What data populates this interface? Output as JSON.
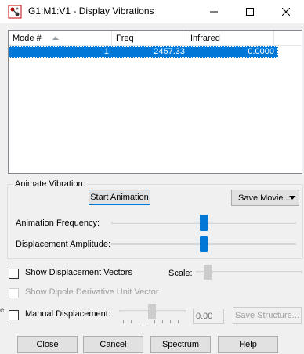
{
  "window": {
    "title": "G1:M1:V1 - Display Vibrations",
    "icons": {
      "app": "molecule-app-icon",
      "minimize": "minimize-icon",
      "maximize": "maximize-icon",
      "close": "close-icon"
    }
  },
  "list": {
    "columns": [
      "Mode #",
      "Freq",
      "Infrared"
    ],
    "sorted_column": "Mode #",
    "rows": [
      {
        "mode": "1",
        "freq": "2457.33",
        "infrared": "0.0000",
        "selected": true
      }
    ]
  },
  "animate": {
    "group_label": "Animate Vibration:",
    "start_button": "Start Animation",
    "save_movie_button": "Save Movie...",
    "frequency_label": "Animation Frequency:",
    "frequency_level": 0.5,
    "amplitude_label": "Displacement Amplitude:",
    "amplitude_level": 0.5
  },
  "options": {
    "show_displacement_vectors": {
      "label": "Show Displacement Vectors",
      "checked": false
    },
    "scale_label": "Scale:",
    "show_dipole": {
      "label": "Show Dipole Derivative Unit Vector",
      "checked": false,
      "enabled": false
    },
    "manual_displacement": {
      "label": "Manual Displacement:",
      "checked": false
    },
    "manual_value": "0.00",
    "save_structure_button": "Save Structure..."
  },
  "buttons": {
    "close": "Close",
    "cancel": "Cancel",
    "spectrum": "Spectrum",
    "help": "Help"
  },
  "colors": {
    "selection": "#0078d7",
    "dialog_bg": "#f0f0f0",
    "slider_thumb": "#0078d7"
  }
}
